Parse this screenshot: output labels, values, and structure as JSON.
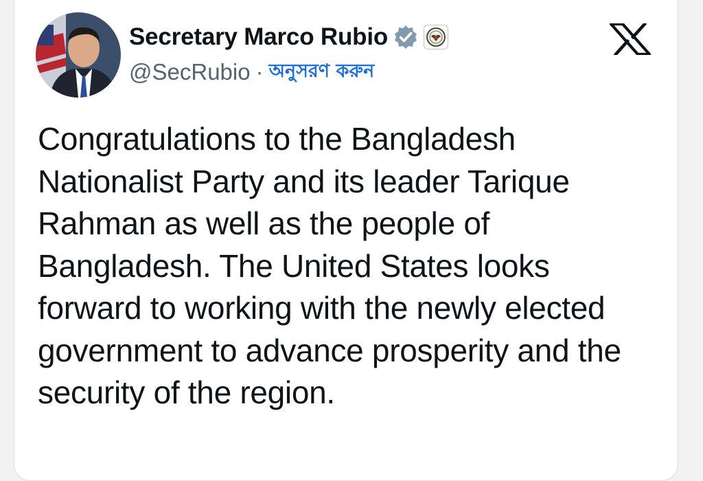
{
  "tweet": {
    "author": {
      "display_name": "Secretary Marco Rubio",
      "handle": "@SecRubio",
      "separator": "·",
      "follow_label": "অনুসরণ করুন"
    },
    "text": "Congratulations to the Bangladesh Nationalist Party and its leader Tarique Rahman as well as the people of Bangladesh. The United States looks forward to working with the newly elected government to advance prosperity and the security of the region."
  },
  "colors": {
    "text_primary": "#0f1419",
    "text_secondary": "#536471",
    "follow_link": "#1d6fd6",
    "verified_badge": "#829aab"
  },
  "icons": {
    "verified": "verified-badge-icon",
    "affiliation": "state-department-seal-icon",
    "brand": "x-logo-icon"
  }
}
